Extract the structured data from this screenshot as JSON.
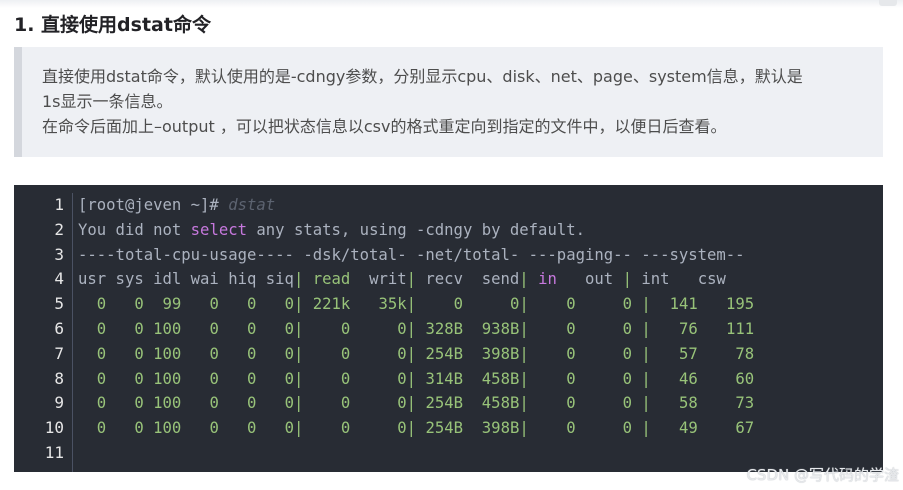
{
  "heading": "1. 直接使用dstat命令",
  "quote": {
    "line1": "直接使用dstat命令，默认使用的是-cdngy参数，分别显示cpu、disk、net、page、system信息，默认是",
    "line2": "1s显示一条信息。",
    "line3": "在命令后面加上–output ，可以把状态信息以csv的格式重定向到指定的文件中，以便日后查看。"
  },
  "code": {
    "line_numbers": [
      "1",
      "2",
      "3",
      "4",
      "5",
      "6",
      "7",
      "8",
      "9",
      "10",
      "11"
    ],
    "prompt": "[root@jeven ~]# ",
    "command": "dstat",
    "msg_before": "You did not ",
    "msg_keyword": "select",
    "msg_after": " any stats, using -cdngy by default.",
    "group_header": "----total-cpu-usage---- -dsk/total- -net/total- ---paging-- ---system--",
    "col_header": {
      "cpu": "usr sys idl wai hiq siq",
      "read": "read",
      "writ": "writ",
      "net": "recv  send",
      "in": "in",
      "out": "out",
      "sys": "int   csw"
    },
    "rows": [
      {
        "usr": "0",
        "sys": "0",
        "idl": "99",
        "wai": "0",
        "hiq": "0",
        "siq": "0",
        "read": "221k",
        "writ": "35k",
        "recv": "0",
        "send": "0",
        "in": "0",
        "out": "0",
        "int": "141",
        "csw": "195"
      },
      {
        "usr": "0",
        "sys": "0",
        "idl": "100",
        "wai": "0",
        "hiq": "0",
        "siq": "0",
        "read": "0",
        "writ": "0",
        "recv": "328B",
        "send": "938B",
        "in": "0",
        "out": "0",
        "int": "76",
        "csw": "111"
      },
      {
        "usr": "0",
        "sys": "0",
        "idl": "100",
        "wai": "0",
        "hiq": "0",
        "siq": "0",
        "read": "0",
        "writ": "0",
        "recv": "254B",
        "send": "398B",
        "in": "0",
        "out": "0",
        "int": "57",
        "csw": "78"
      },
      {
        "usr": "0",
        "sys": "0",
        "idl": "100",
        "wai": "0",
        "hiq": "0",
        "siq": "0",
        "read": "0",
        "writ": "0",
        "recv": "314B",
        "send": "458B",
        "in": "0",
        "out": "0",
        "int": "46",
        "csw": "60"
      },
      {
        "usr": "0",
        "sys": "0",
        "idl": "100",
        "wai": "0",
        "hiq": "0",
        "siq": "0",
        "read": "0",
        "writ": "0",
        "recv": "254B",
        "send": "458B",
        "in": "0",
        "out": "0",
        "int": "58",
        "csw": "73"
      },
      {
        "usr": "0",
        "sys": "0",
        "idl": "100",
        "wai": "0",
        "hiq": "0",
        "siq": "0",
        "read": "0",
        "writ": "0",
        "recv": "254B",
        "send": "398B",
        "in": "0",
        "out": "0",
        "int": "49",
        "csw": "67"
      }
    ]
  },
  "watermark": "CSDN @写代码的学渣",
  "colors": {
    "code_bg": "#282c34",
    "keyword": "#c678dd",
    "number": "#98c379",
    "comment": "#5c6370"
  }
}
